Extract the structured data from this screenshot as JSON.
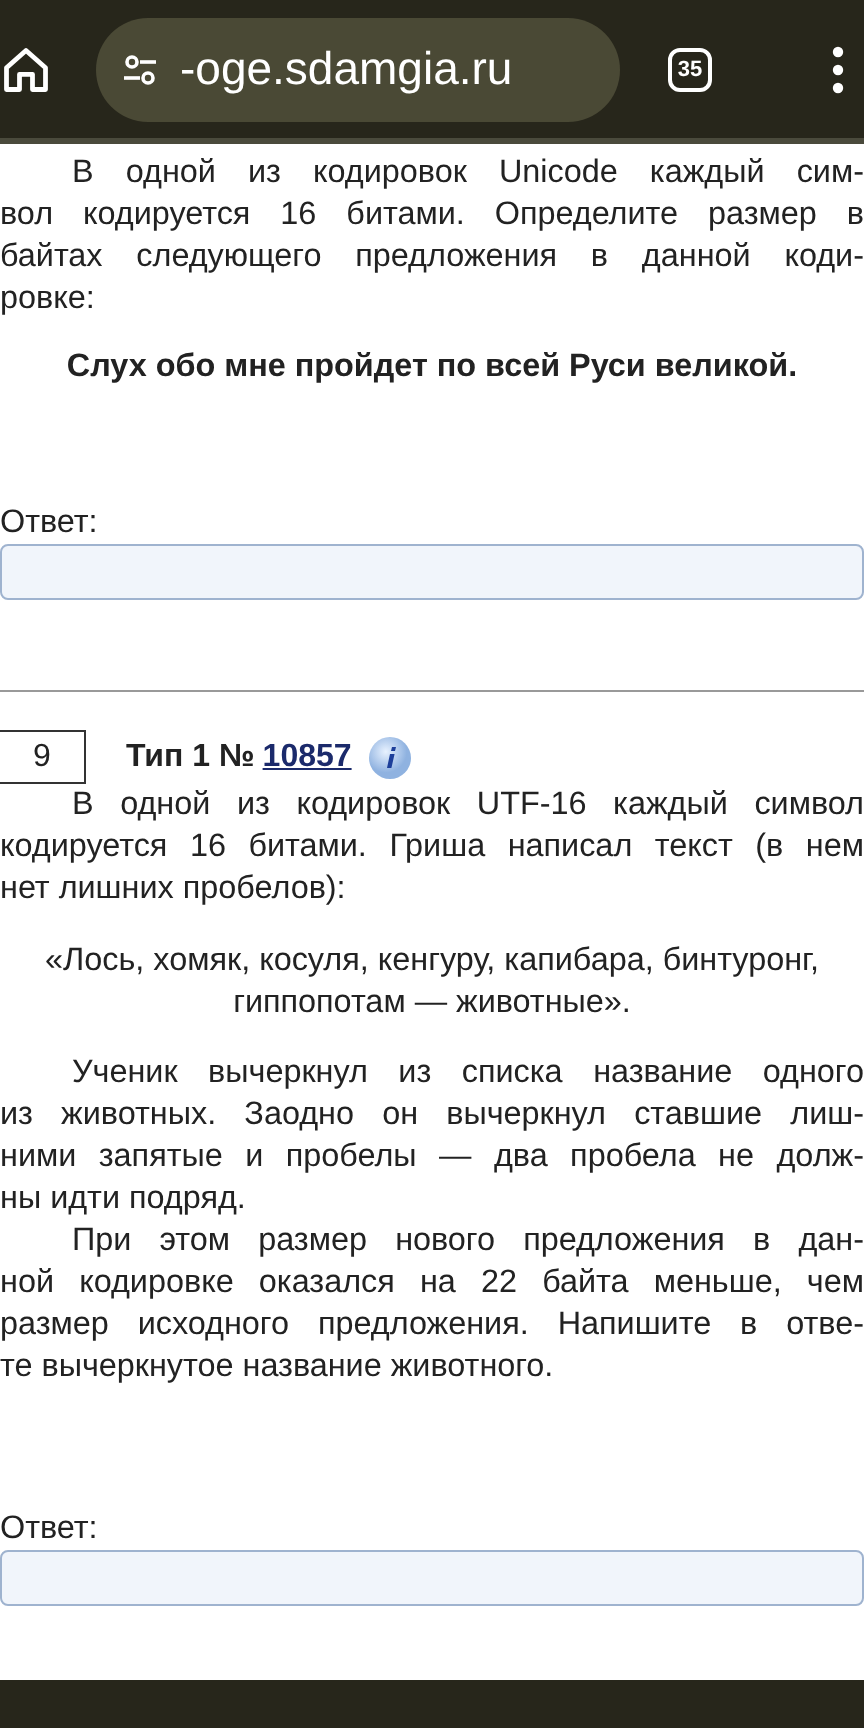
{
  "browser": {
    "url": "-oge.sdamgia.ru",
    "tab_count": "35"
  },
  "task_prev": {
    "paragraphs": [
      [
        "В одной из кодировок Unicode каждый сим-",
        "вол кодируется 16 битами. Определите размер в",
        "байтах следующего предложения в данной коди-",
        "ровке:"
      ]
    ],
    "sentence": "Слух обо мне пройдет по всей Руси великой.",
    "answer_label": "Ответ:"
  },
  "task": {
    "number": "9",
    "type_label": "Тип 1 №",
    "id_link": "10857",
    "paragraphs": [
      [
        "В одной из кодировок UTF-16 каждый символ",
        "кодируется 16 битами. Гриша написал текст (в нем",
        "нет лишних пробелов):"
      ]
    ],
    "quote": [
      "«Лось, хомяк, косуля, кенгуру, капибара, бинтуронг,",
      "гиппопотам  — животные»."
    ],
    "paragraphs2": [
      [
        "Ученик вычеркнул из списка название одного",
        "из животных. Заодно он вычеркнул ставшие лиш-",
        "ними запятые и пробелы  — два пробела не долж-",
        "ны идти подряд."
      ],
      [
        "При этом размер нового предложения в дан-",
        "ной кодировке оказался на 22 байта меньше, чем",
        "размер исходного предложения. Напишите в отве-",
        "те вычеркнутое название животного."
      ]
    ],
    "answer_label": "Ответ:"
  }
}
